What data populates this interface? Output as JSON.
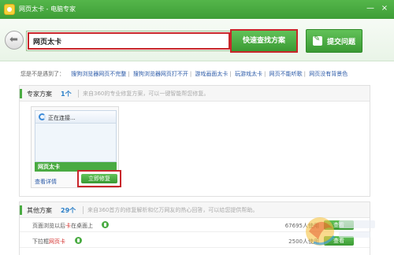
{
  "window": {
    "title": "网页太卡 - 电脑专家",
    "minimize": "—",
    "close": "×"
  },
  "search": {
    "value": "网页太卡",
    "button": "快速查找方案",
    "submit": "提交问题"
  },
  "suggestions": {
    "question": "您是不是遇到了：",
    "items": [
      "搜狗浏览器网页不完整",
      "搜狗浏览器网页打不开",
      "游戏画面太卡",
      "玩游戏太卡",
      "网页不能听歌",
      "网页没有背景色"
    ]
  },
  "expert": {
    "title": "专家方案",
    "count": "1个",
    "desc": "来自360的专业修复方案，可以一键智能帮您修复。",
    "card": {
      "thumb_caption": "正在连接...",
      "name": "网页太卡",
      "view": "查看详情",
      "repair": "立即修复"
    }
  },
  "others": {
    "title": "其他方案",
    "count": "29个",
    "desc": "来自360首方的修复解析和亿万网友的热心回答，可以给您提供帮助。",
    "rows": [
      {
        "prefix": "页面浏览以后",
        "highlight": "卡",
        "suffix": "在桌面上",
        "users": "67695人使用",
        "action": "查看"
      },
      {
        "prefix": "下拉框",
        "highlight": "网页卡",
        "suffix": "",
        "users": "2500人使用",
        "action": "查看"
      }
    ]
  },
  "colors": {
    "accent": "#4aab42",
    "highlight_box": "#c8262a",
    "link": "#2b5aa8"
  }
}
